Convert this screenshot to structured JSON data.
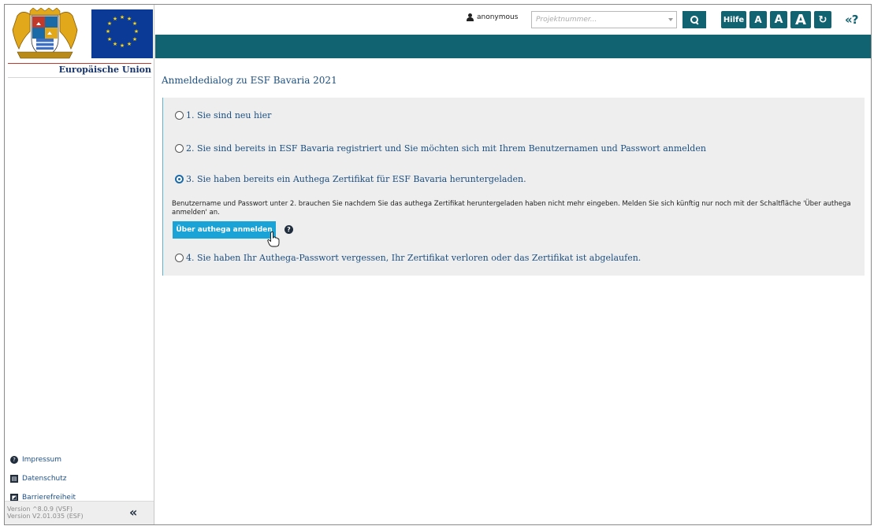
{
  "sidebar": {
    "eu_label": "Europäische Union",
    "links": [
      {
        "label": "Impressum",
        "icon": "help-icon"
      },
      {
        "label": "Datenschutz",
        "icon": "datenschutz-icon"
      },
      {
        "label": "Barrierefreiheit",
        "icon": "accessibility-icon"
      }
    ],
    "version_vsf": "Version ^8.0.9 (VSF)",
    "version_esf": "Version V2.01.035 (ESF)",
    "collapse_glyph": "«"
  },
  "header": {
    "user": "anonymous",
    "project_placeholder": "Projektnummer...",
    "hilfe": "Hilfe",
    "font_small": "A",
    "font_medium": "A",
    "font_large": "A",
    "refresh_glyph": "↻",
    "back_glyph": "«?"
  },
  "main": {
    "title": "Anmeldedialog zu ESF Bavaria 2021",
    "options": [
      {
        "label": "1. Sie sind neu hier",
        "checked": false
      },
      {
        "label": "2. Sie sind bereits in ESF Bavaria registriert und Sie möchten sich mit Ihrem Benutzernamen und Passwort anmelden",
        "checked": false
      },
      {
        "label": "3. Sie haben bereits ein Authega Zertifikat für ESF Bavaria heruntergeladen.",
        "checked": true
      },
      {
        "label": "4. Sie haben Ihr Authega-Passwort vergessen, Ihr Zertifikat verloren oder das Zertifikat ist abgelaufen.",
        "checked": false
      }
    ],
    "hint": "Benutzername und Passwort unter 2. brauchen Sie nachdem Sie das authega Zertifikat heruntergeladen haben nicht mehr eingeben. Melden Sie sich künftig nur noch mit der Schaltfläche 'Über authega anmelden' an.",
    "authega_button": "Über authega anmelden",
    "help_glyph": "?"
  },
  "colors": {
    "teal": "#126371",
    "accent_button": "#1aa3d6",
    "link_blue": "#1c4f80",
    "panel_bg": "#eeeeee"
  }
}
